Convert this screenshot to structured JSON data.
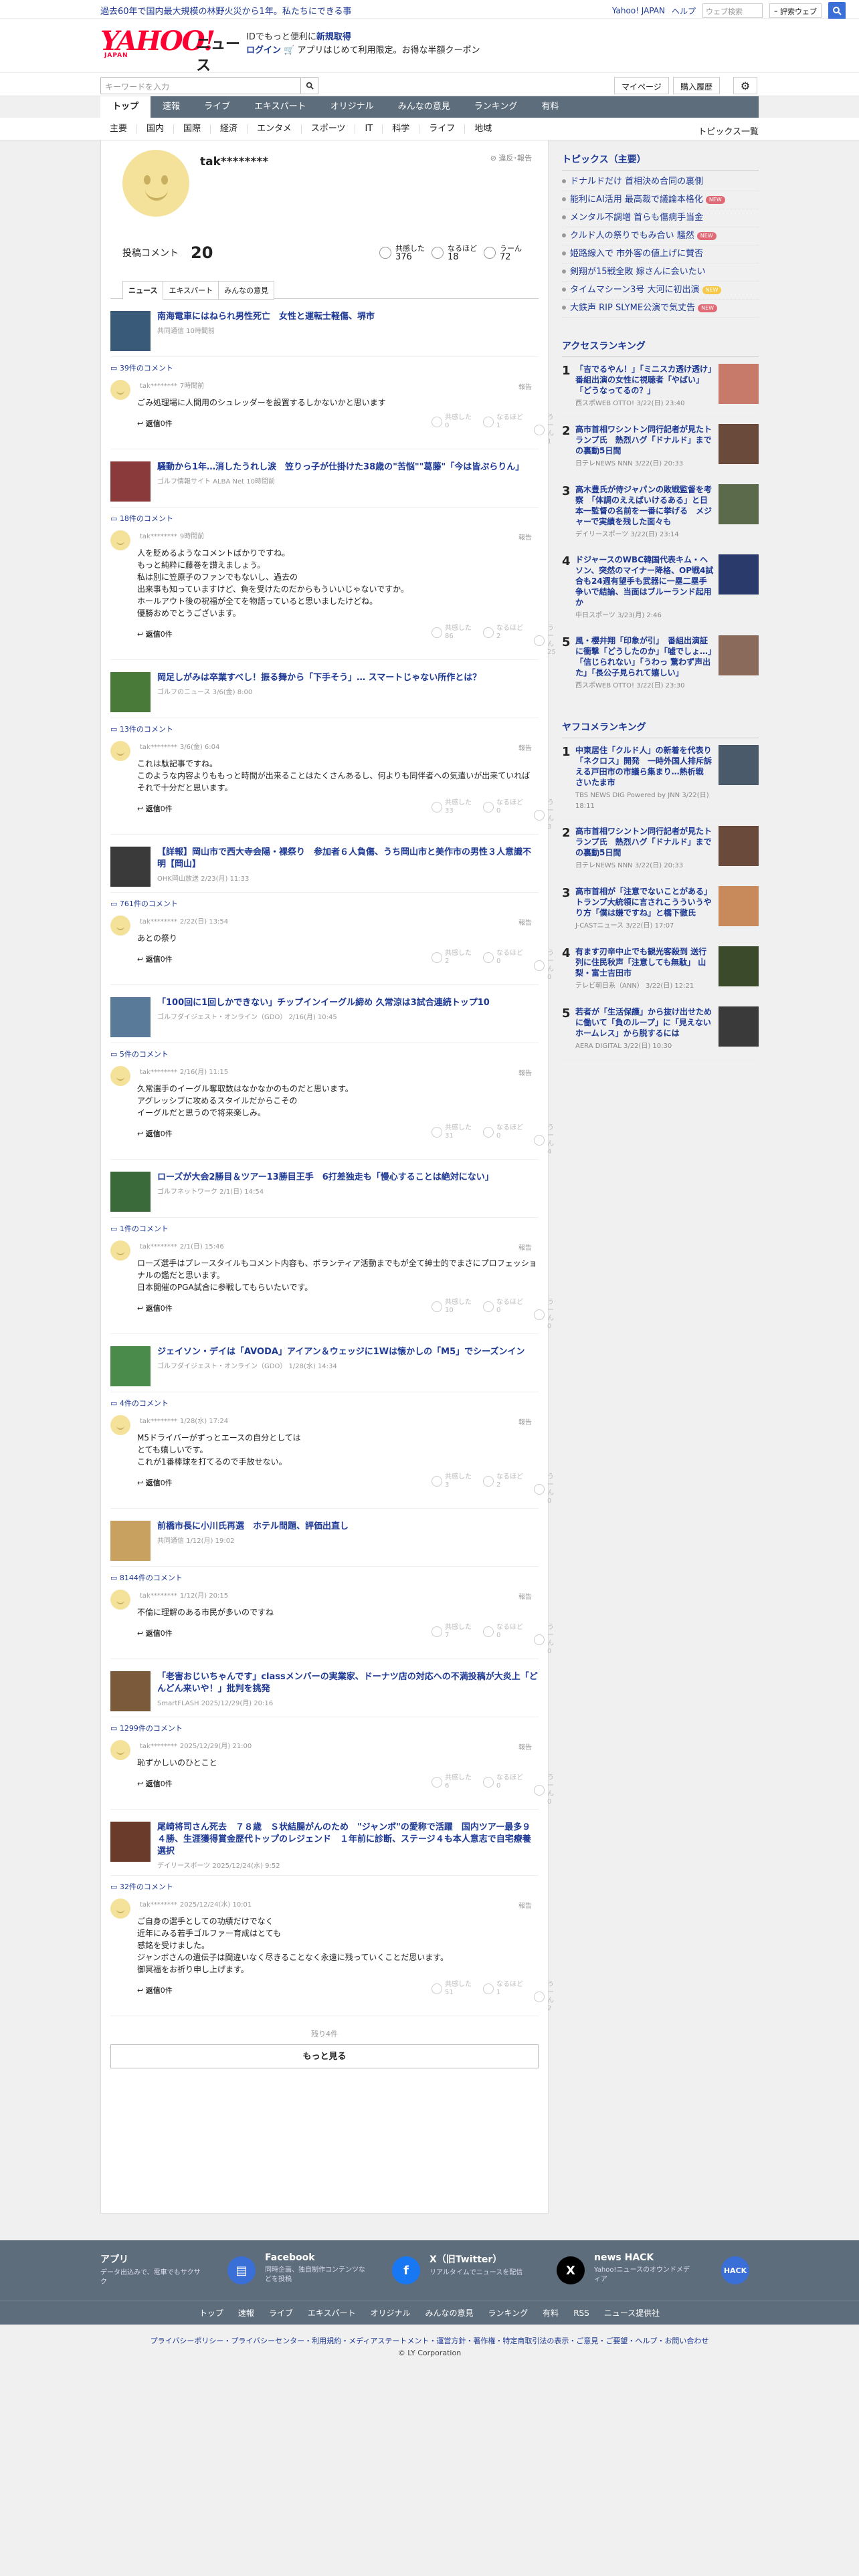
{
  "topbar": {
    "news": "過去60年で国内最大規模の林野火災から1年。私たちにできる事",
    "links": [
      "Yahoo! JAPAN",
      "ヘルプ"
    ],
    "search_placeholder": "ウェブ検索",
    "search_btn": "ｰ 評索ウェブ"
  },
  "header": {
    "logo_main": "YAHOO!",
    "logo_sub": "JAPAN",
    "logo_news": "ニュース",
    "promo_l1": "IDでもっと便利に",
    "promo_l1_bold": "新規取得",
    "promo_login": "ログイン",
    "promo_l2": "アプリはじめて利用限定。お得な半額クーポン"
  },
  "searchbar": {
    "placeholder": "キーワードを入力",
    "mypage": "マイページ",
    "history": "購入履歴"
  },
  "nav": [
    "トップ",
    "速報",
    "ライブ",
    "エキスパート",
    "オリジナル",
    "みんなの意見",
    "ランキング",
    "有料"
  ],
  "subnav": [
    "主要",
    "国内",
    "国際",
    "経済",
    "エンタメ",
    "スポーツ",
    "IT",
    "科学",
    "ライフ",
    "地域"
  ],
  "subnav_all": "トピックス一覧",
  "profile": {
    "name": "tak********",
    "violation": "違反･報告",
    "comments_label": "投稿コメント",
    "comments_count": "20",
    "agree_label": "共感した",
    "agree_count": "376",
    "hmm_label": "なるほど",
    "hmm_count": "18",
    "umm_label": "うーん",
    "umm_count": "72",
    "tabs": [
      "ニュース",
      "エキスパート",
      "みんなの意見"
    ]
  },
  "entries": [
    {
      "title": "南海電車にはねられ男性死亡　女性と運転士軽傷、堺市",
      "src": "共同通信 10時間前",
      "count": "39件のコメント",
      "time": "7時間前",
      "body": "ごみ処理場に人間用のシュレッダーを設置するしかないかと思います",
      "r": [
        "0",
        "1",
        "1"
      ],
      "tc": "#3a5a7a"
    },
    {
      "title": "騒動から1年…消したうれし涙　笠りっ子が仕掛けた38歳の\"苦悩\"\"葛藤\"「今は皆ぷらりん」",
      "src": "ゴルフ情報サイト ALBA Net 10時間前",
      "count": "18件のコメント",
      "time": "9時間前",
      "body": "人を貶めるようなコメントばかりですね。\nもっと純粋に藤巻を讃えましょう。\n私は別に笠原子のファンでもないし、過去の\n出来事も知っていますけど、負を受けたのだからもういいじゃないですか。\nホールアウト後の祝福が全てを物語っていると思いましたけどね。\n優勝おめでとうございます。",
      "r": [
        "86",
        "2",
        "25"
      ],
      "tc": "#8a3a3a"
    },
    {
      "title": "岡足しがみは卒業すべし！振る舞から「下手そう」… スマートじゃない所作とは？",
      "src": "ゴルフのニュース 3/6(金) 8:00",
      "count": "13件のコメント",
      "time": "3/6(金) 6:04",
      "body": "これは駄記事ですね。\nこのような内容よりももっと時間が出来ることはたくさんあるし、何よりも同伴者への気遣いが出来ていれば それで十分だと思います。",
      "r": [
        "33",
        "0",
        "3"
      ],
      "tc": "#4a7a3a"
    },
    {
      "title": "【詳報】岡山市で西大寺会陽・裸祭り　参加者６人負傷、うち岡山市と美作市の男性３人意識不明【岡山】",
      "src": "OHK岡山放送 2/23(月) 11:33",
      "count": "761件のコメント",
      "time": "2/22(日) 13:54",
      "body": "あとの祭り",
      "r": [
        "2",
        "0",
        "0"
      ],
      "tc": "#3a3a3a"
    },
    {
      "title": "「100回に1回しかできない」チップインイーグル締め 久常涼は3試合連続トップ10",
      "src": "ゴルフダイジェスト・オンライン（GDO） 2/16(月) 10:45",
      "count": "5件のコメント",
      "time": "2/16(月) 11:15",
      "body": "久常選手のイーグル奪取数はなかなかのものだと思います。\nアグレッシブに攻めるスタイルだからこその\nイーグルだと思うので将来楽しみ。",
      "r": [
        "31",
        "0",
        "4"
      ],
      "tc": "#5a7a9a"
    },
    {
      "title": "ローズが大会2勝目＆ツアー13勝目王手　6打差独走も「慢心することは絶対にない」",
      "src": "ゴルフネットワーク 2/1(日) 14:54",
      "count": "1件のコメント",
      "time": "2/1(日) 15:46",
      "body": "ローズ選手はプレースタイルもコメント内容も、ボランティア活動までもが全て紳士的でまさにプロフェッショナルの鑑だと思います。\n日本開催のPGA試合に参戦してもらいたいです。",
      "r": [
        "10",
        "0",
        "0"
      ],
      "tc": "#3a6a3a"
    },
    {
      "title": "ジェイソン・デイは「AVODA」アイアン＆ウェッジに1Wは懐かしの「M5」でシーズンイン",
      "src": "ゴルフダイジェスト・オンライン（GDO） 1/28(水) 14:34",
      "count": "4件のコメント",
      "time": "1/28(水) 17:24",
      "body": "M5ドライバーがずっとエースの自分としては\nとても嬉しいです。\nこれが1番棒球を打てるので手放せない。",
      "r": [
        "3",
        "2",
        "0"
      ],
      "tc": "#4a8a4a"
    },
    {
      "title": "前橋市長に小川氏再選　ホテル問題、評価出直し",
      "src": "共同通信 1/12(月) 19:02",
      "count": "8144件のコメント",
      "time": "1/12(月) 20:15",
      "body": "不倫に理解のある市民が多いのですね",
      "r": [
        "7",
        "0",
        "0"
      ],
      "tc": "#c8a060"
    },
    {
      "title": "「老害おじいちゃんです」classメンバーの実業家、ドーナツ店の対応への不満投稿が大炎上「どんどん来いや！」批判を挑発",
      "src": "SmartFLASH 2025/12/29(月) 20:16",
      "count": "1299件のコメント",
      "time": "2025/12/29(月) 21:00",
      "body": "恥ずかしいのひとこと",
      "r": [
        "6",
        "0",
        "0"
      ],
      "tc": "#7a5a3a"
    },
    {
      "title": "尾崎将司さん死去　７８歳　Ｓ状結腸がんのため　\"ジャンボ\"の愛称で活躍　国内ツアー最多９４勝、生涯獲得賞金歴代トップのレジェンド　１年前に診断、ステージ４も本人意志で自宅療養選択",
      "src": "デイリースポーツ 2025/12/24(水) 9:52",
      "count": "32件のコメント",
      "time": "2025/12/24(水) 10:01",
      "body": "ご自身の選手としての功績だけでなく\n近年にみる若手ゴルファー育成はとても\n感銘を受けました。\nジャンボさんの遺伝子は間違いなく尽きることなく永遠に残っていくことだ思います。\n御冥福をお祈り申し上げます。",
      "r": [
        "51",
        "1",
        "2"
      ],
      "tc": "#6a3a2a"
    }
  ],
  "reply_label": "返信",
  "reply_count": "0件",
  "report": "報告",
  "react_labels": [
    "共感した",
    "なるほど",
    "うーん"
  ],
  "more_remain": "残り4件",
  "more_btn": "もっと見る",
  "topics": {
    "title": "トピックス（主要）",
    "items": [
      {
        "t": "ドナルドだけ 首相決め合同の裏側",
        "b": ""
      },
      {
        "t": "能利にAI活用 最高裁で議論本格化",
        "b": "new"
      },
      {
        "t": "メンタル不調増 首らも傷病手当金",
        "b": ""
      },
      {
        "t": "クルド人の祭りでもみ合い 騒然",
        "b": "new"
      },
      {
        "t": "姫路線入で 市外客の値上げに賛否",
        "b": ""
      },
      {
        "t": "剣翔が15戦全敗 嫁さんに会いたい",
        "b": ""
      },
      {
        "t": "タイムマシーン3号 大河に初出演",
        "b": "new"
      },
      {
        "t": "大鉄声 RIP SLYME公演で気丈告",
        "b": "new"
      }
    ]
  },
  "access": {
    "title": "アクセスランキング",
    "items": [
      {
        "n": "1",
        "t": "「吉でるやん！」「ミニスカ透け透け」番組出演の女性に視聴者「やばい」「どうなってるの？」",
        "s": "西スポWEB OTTO! 3/22(日) 23:40",
        "c": "#c87a6a"
      },
      {
        "n": "2",
        "t": "高市首相ワシントン同行記者が見たトランプ氏　熱烈ハグ「ドナルド」までの裏動5日間",
        "s": "日テレNEWS NNN 3/22(日) 20:33",
        "c": "#6a4a3a"
      },
      {
        "n": "3",
        "t": "高木豊氏が侍ジャパンの敗戦監督を考察　「体調のええばいけるある」と日本一監督の名前を一番に挙げる　メジャーで実績を残した面々も",
        "s": "デイリースポーツ 3/22(日) 23:14",
        "c": "#5a6a4a"
      },
      {
        "n": "4",
        "t": "ドジャースのWBC韓国代表キム・ヘソン、突然のマイナー降格、OP戦4試合も24週有望手も武器に一塁二塁手争いで結論、当面はブルーランド起用か",
        "s": "中日スポーツ 3/23(月) 2:46",
        "c": "#2a3a6a"
      },
      {
        "n": "5",
        "t": "風・櫻井翔「印象が引」　番組出演証に衝撃「どうしたのか」「嘘でしょ…」「信じられない」「うわっ 驚わず声出た」「長公子見られて嬉しい」",
        "s": "西スポWEB OTTO! 3/22(日) 23:30",
        "c": "#8a6a5a"
      }
    ]
  },
  "yahoo": {
    "title": "ヤフコメランキング",
    "items": [
      {
        "n": "1",
        "t": "中東居住「クルド人」の新着を代表り「ネクロス」開発　一時外国人排斥訴える戸田市の市議ら集まり…熱析戦　さいたま市",
        "s": "TBS NEWS DIG Powered by JNN 3/22(日) 18:11",
        "c": "#4a5a6a"
      },
      {
        "n": "2",
        "t": "高市首相ワシントン同行記者が見たトランプ氏　熱烈ハグ「ドナルド」までの裏動5日間",
        "s": "日テレNEWS NNN 3/22(日) 20:33",
        "c": "#6a4a3a"
      },
      {
        "n": "3",
        "t": "高市首相が「注意でないことがある」トランプ大統領に言されこうういうやり方「僕は嫌ですね」と橋下徹氏",
        "s": "J-CASTニュース 3/22(日) 17:07",
        "c": "#c88a5a"
      },
      {
        "n": "4",
        "t": "有ます刃辛中止でも観光客殺到 送行列に住民秋声「注意しても無駄」 山梨・富士吉田市",
        "s": "テレビ朝日系（ANN） 3/22(日) 12:21",
        "c": "#3a4a2a"
      },
      {
        "n": "5",
        "t": "若者が「生活保護」から抜け出せために働いて「負のループ」に「見えないホームレス」から脱するには",
        "s": "AERA DIGITAL 3/22(日) 10:30",
        "c": "#3a3a3a"
      }
    ]
  },
  "appbar": [
    {
      "h": "アプリ",
      "d": "データ出込みで、電車でもサクサク",
      "ic": "#3a6fd8",
      "g": "▤"
    },
    {
      "h": "Facebook",
      "d": "同時企画、独自制作コンテンツなどを投稿",
      "ic": "#1877f2",
      "g": "f"
    },
    {
      "h": "X（旧Twitter）",
      "d": "リアルタイムでニュースを配信",
      "ic": "#000000",
      "g": "X"
    },
    {
      "h": "news HACK",
      "d": "Yahoo!ニュースのオウンドメディア",
      "ic": "#3a6fd8",
      "g": "HACK"
    }
  ],
  "footer_nav": [
    "トップ",
    "速報",
    "ライブ",
    "エキスパート",
    "オリジナル",
    "みんなの意見",
    "ランキング",
    "有料",
    "RSS",
    "ニュース提供社"
  ],
  "footer_links": "プライバシーポリシー・プライバシーセンター・利用規約・メディアステートメント・運営方針・著作権・特定商取引法の表示・ご意見・ご要望・ヘルプ・お問い合わせ",
  "copyright": "© LY Corporation",
  "colors": {
    "brand": "#ff0033",
    "link": "#1d3994",
    "nav": "#5d6d7c"
  }
}
